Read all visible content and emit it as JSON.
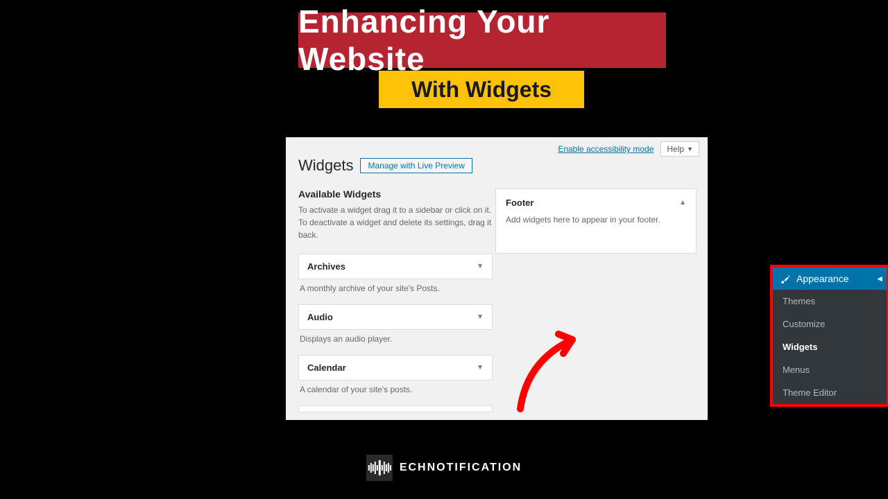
{
  "titles": {
    "main": "Enhancing Your Website",
    "sub": "With Widgets"
  },
  "wp": {
    "topLinks": {
      "accessibility": "Enable accessibility mode",
      "help": "Help"
    },
    "heading": "Widgets",
    "previewBtn": "Manage with Live Preview",
    "available": {
      "title": "Available Widgets",
      "desc": "To activate a widget drag it to a sidebar or click on it. To deactivate a widget and delete its settings, drag it back."
    },
    "widgets": [
      {
        "name": "Archives",
        "desc": "A monthly archive of your site's Posts."
      },
      {
        "name": "Audio",
        "desc": "Displays an audio player."
      },
      {
        "name": "Calendar",
        "desc": "A calendar of your site's posts."
      }
    ],
    "footerArea": {
      "title": "Footer",
      "desc": "Add widgets here to appear in your footer."
    },
    "menu": {
      "head": "Appearance",
      "items": [
        "Themes",
        "Customize",
        "Widgets",
        "Menus",
        "Theme Editor"
      ],
      "activeIndex": 2
    }
  },
  "brand": {
    "text": "ECHNOTIFICATION"
  }
}
